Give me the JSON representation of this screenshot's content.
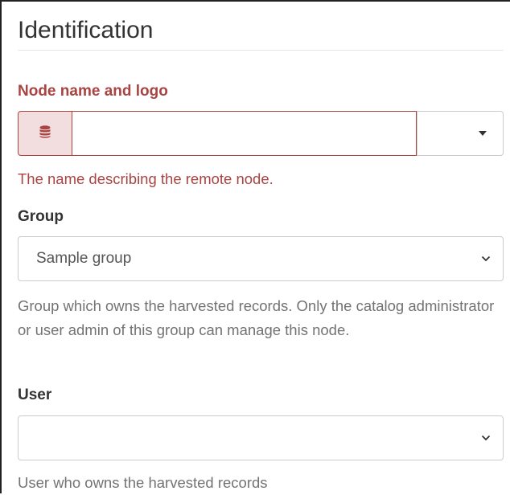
{
  "section": {
    "title": "Identification"
  },
  "node_name": {
    "label": "Node name and logo",
    "addon_icon": "database-icon",
    "value": "",
    "logo_dropdown_icon": "caret-down-icon",
    "help": "The name describing the remote node.",
    "error_color": "#a94442"
  },
  "group": {
    "label": "Group",
    "selected": "Sample group",
    "help": "Group which owns the harvested records. Only the catalog administrator or user admin of this group can manage this node."
  },
  "user": {
    "label": "User",
    "selected": "",
    "help": "User who owns the harvested records"
  }
}
